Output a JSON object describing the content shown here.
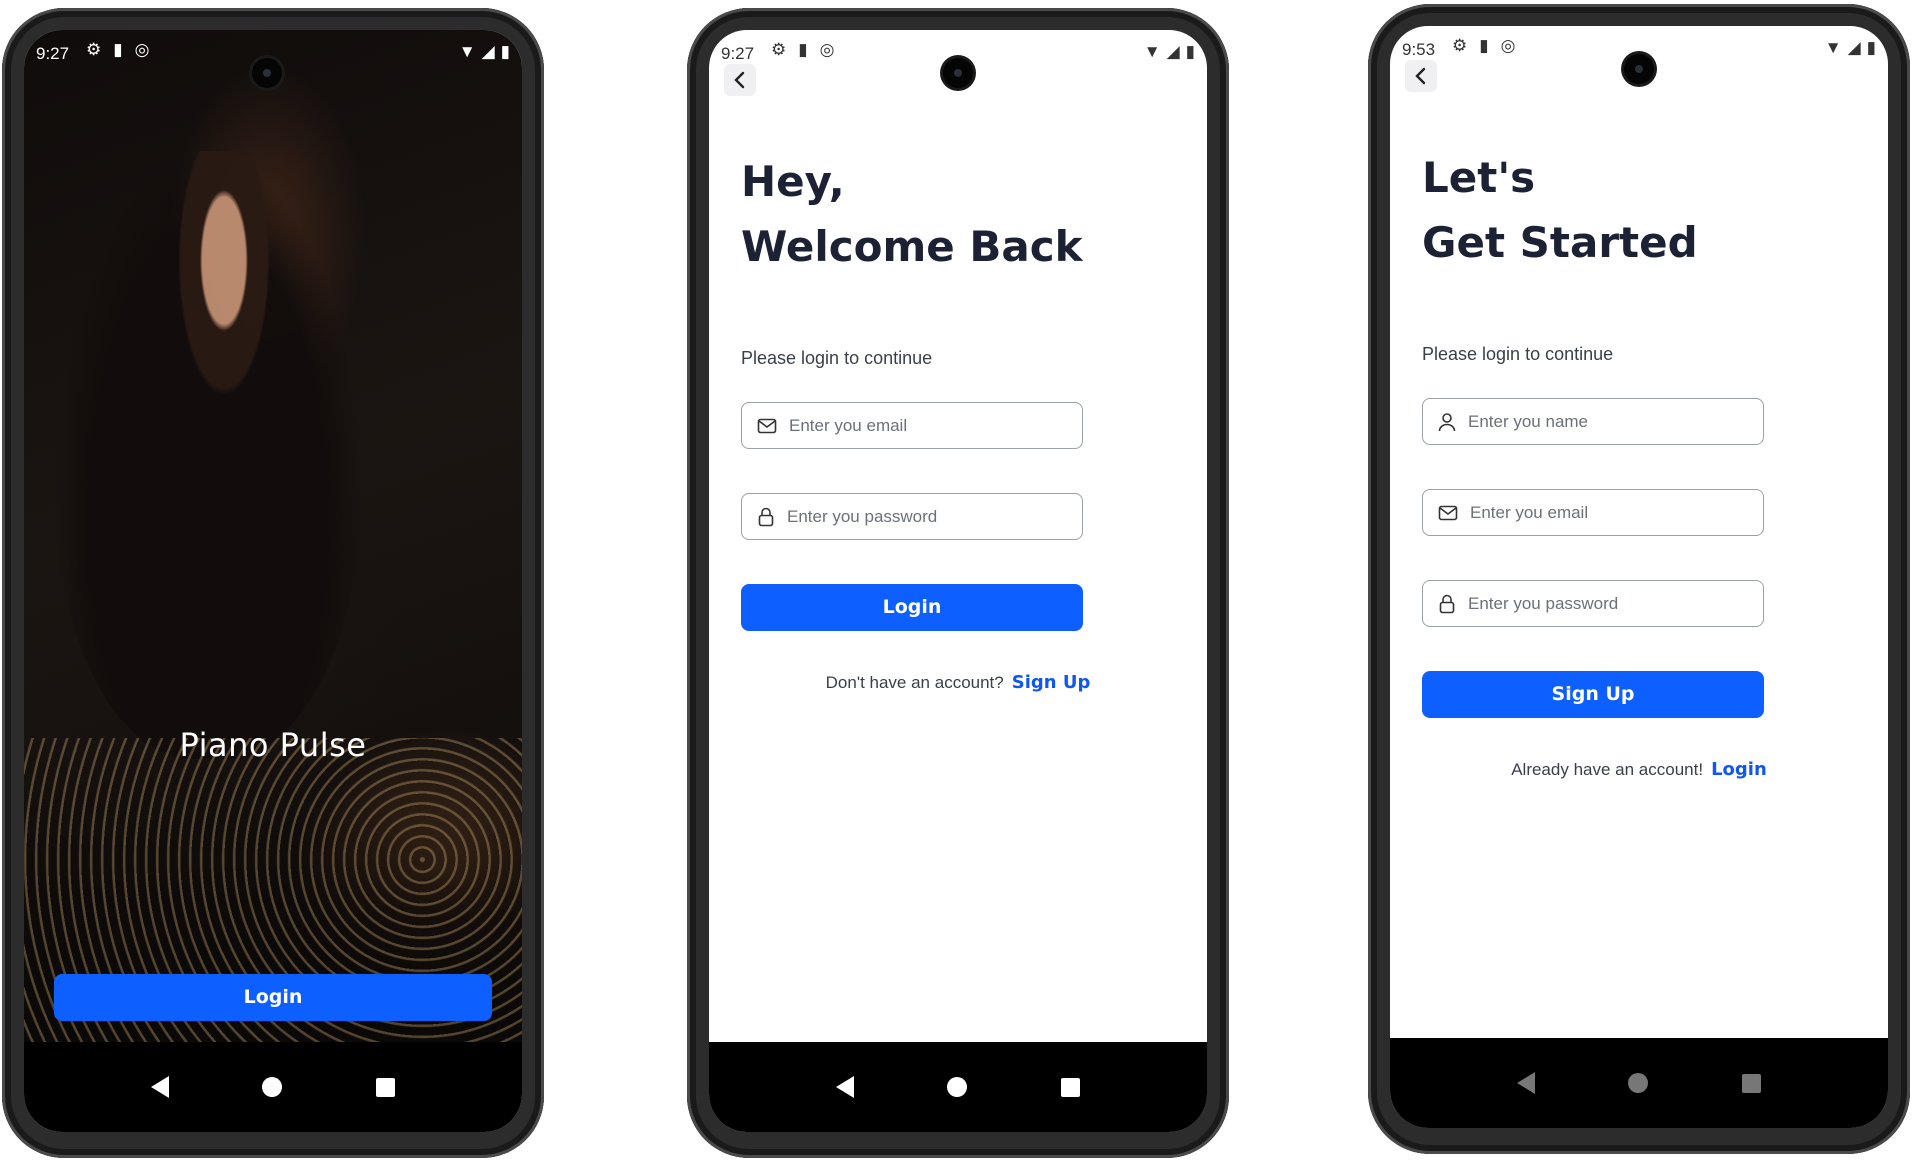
{
  "colors": {
    "accent": "#0d5fff",
    "link": "#1256f0",
    "heading": "#1c2233"
  },
  "screens": [
    {
      "id": "welcome",
      "status_time": "9:27",
      "status_icons": [
        "gear-icon",
        "sd-card-icon",
        "at-sign-icon"
      ],
      "title": "Piano Pulse",
      "login_button": "Login"
    },
    {
      "id": "login",
      "status_time": "9:27",
      "heading_line1": "Hey,",
      "heading_line2": "Welcome Back",
      "subtitle": "Please login to continue",
      "email_placeholder": "Enter you email",
      "password_placeholder": "Enter you password",
      "button": "Login",
      "footer_text": "Don't have an account?",
      "footer_link": "Sign Up"
    },
    {
      "id": "signup",
      "status_time": "9:53",
      "heading_line1": "Let's",
      "heading_line2": "Get Started",
      "subtitle": "Please login to continue",
      "name_placeholder": "Enter you name",
      "email_placeholder": "Enter you email",
      "password_placeholder": "Enter you password",
      "button": "Sign Up",
      "footer_text": "Already have an account!",
      "footer_link": "Login"
    }
  ]
}
